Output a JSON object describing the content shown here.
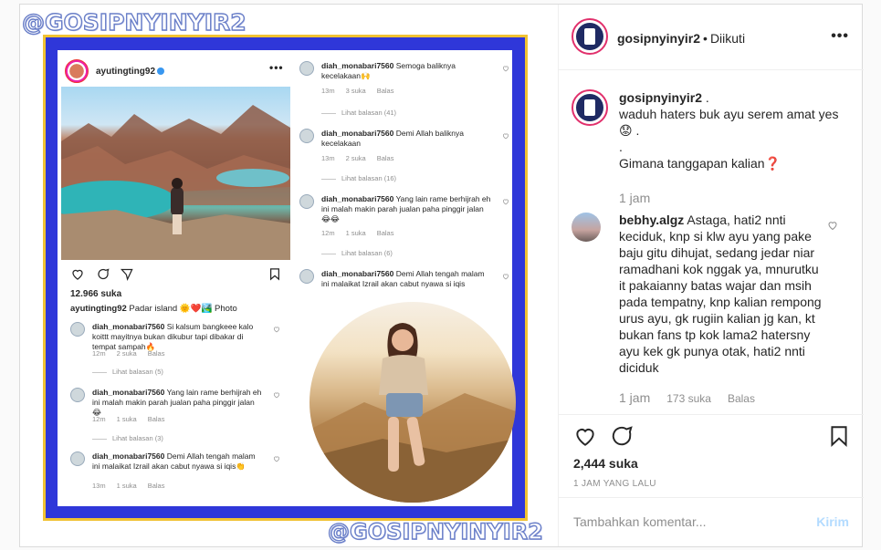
{
  "post": {
    "author": "gosipnyinyir2",
    "separator": "•",
    "follow_status": "Diikuti",
    "more_icon": "more-horizontal-icon"
  },
  "media": {
    "watermark": "@GOSIPNYINYIR2",
    "inner_post": {
      "username": "ayutingting92",
      "likes": "12.966 suka",
      "caption_user": "ayutingting92",
      "caption_text": "Padar island 🌞❤️🏞️ Photo",
      "comments_left": [
        {
          "user": "diah_monabari7560",
          "text": "Si kalsum bangkeee kalo koittt mayitnya bukan dikubur tapi dibakar di tempat sampah🔥",
          "time": "12m",
          "likes": "2 suka",
          "reply": "Balas",
          "view_replies": "Lihat balasan (5)"
        },
        {
          "user": "diah_monabari7560",
          "text": "Yang lain rame berhijrah eh ini malah makin parah jualan paha pinggir jalan😂",
          "time": "12m",
          "likes": "1 suka",
          "reply": "Balas",
          "view_replies": "Lihat balasan (3)"
        },
        {
          "user": "diah_monabari7560",
          "text": "Demi Allah tengah malam ini malaikat Izrail akan cabut nyawa si iqis👏",
          "time": "13m",
          "likes": "1 suka",
          "reply": "Balas",
          "view_replies": ""
        }
      ],
      "comments_right": [
        {
          "user": "diah_monabari7560",
          "text": "Semoga baliknya kecelakaan🙌",
          "time": "13m",
          "likes": "3 suka",
          "reply": "Balas",
          "view_replies": "Lihat balasan (41)"
        },
        {
          "user": "diah_monabari7560",
          "text": "Demi Allah baliknya kecelakaan",
          "time": "13m",
          "likes": "2 suka",
          "reply": "Balas",
          "view_replies": "Lihat balasan (16)"
        },
        {
          "user": "diah_monabari7560",
          "text": "Yang lain rame berhijrah eh ini malah makin parah jualan paha pinggir jalan😂😂",
          "time": "12m",
          "likes": "1 suka",
          "reply": "Balas",
          "view_replies": "Lihat balasan (6)"
        },
        {
          "user": "diah_monabari7560",
          "text": "Demi Allah tengah malam ini malaikat Izrail akan cabut nyawa si iqis",
          "time": "",
          "likes": "",
          "reply": "",
          "view_replies": ""
        }
      ]
    }
  },
  "caption": {
    "user": "gosipnyinyir2",
    "line1": " .",
    "line2": "waduh haters buk ayu serem amat yes 😟 .",
    "line3": ".",
    "line4": "Gimana tanggapan kalian❓",
    "time": "1 jam"
  },
  "comment": {
    "user": "bebhy.algz",
    "text": " Astaga, hati2 nnti keciduk, knp si klw ayu yang pake baju gitu dihujat, sedang jedar niar ramadhani kok nggak ya, mnurutku it pakaianny batas wajar dan msih pada tempatny, knp kalian rempong urus ayu, gk rugiin kalian jg kan, kt bukan fans tp kok lama2 hatersny ayu kek gk punya otak, hati2 nnti diciduk",
    "time": "1 jam",
    "likes": "173 suka",
    "reply": "Balas"
  },
  "actions": {
    "likes": "2,444 suka",
    "posted_ago": "1 JAM YANG LALU"
  },
  "add_comment": {
    "placeholder": "Tambahkan komentar...",
    "send_label": "Kirim"
  }
}
